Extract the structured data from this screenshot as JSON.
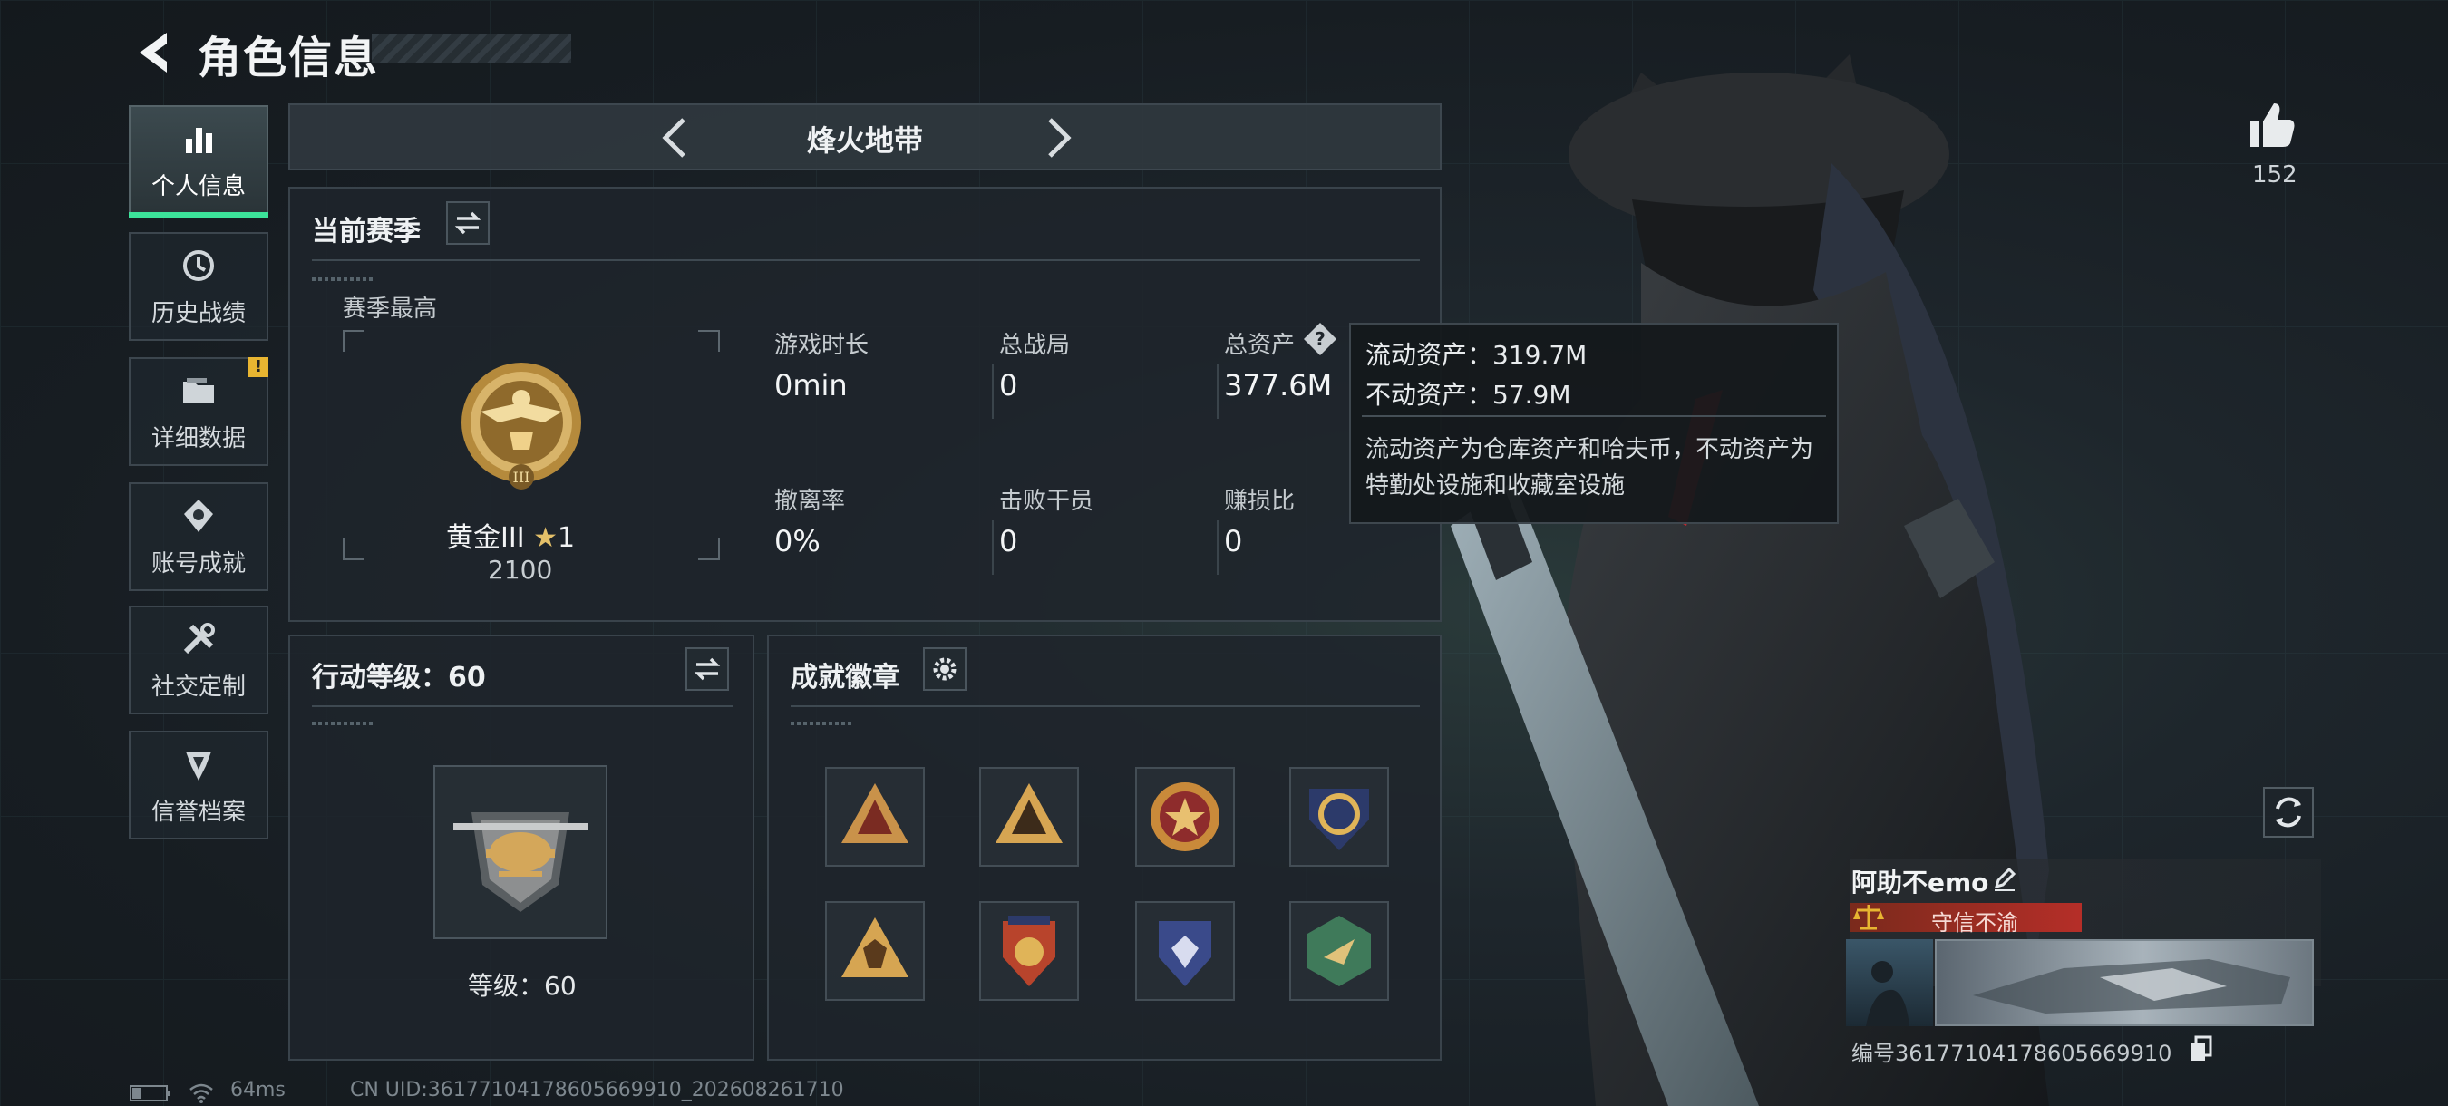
{
  "header": {
    "title": "角色信息"
  },
  "sidebar": {
    "items": [
      {
        "label": "个人信息",
        "icon": "bar-chart-icon",
        "active": true
      },
      {
        "label": "历史战绩",
        "icon": "history-clock-icon"
      },
      {
        "label": "详细数据",
        "icon": "folder-icon",
        "alert": "!"
      },
      {
        "label": "账号成就",
        "icon": "achievement-icon"
      },
      {
        "label": "社交定制",
        "icon": "tools-icon"
      },
      {
        "label": "信誉档案",
        "icon": "shield-icon"
      }
    ]
  },
  "mode": {
    "name": "烽火地带"
  },
  "season": {
    "title": "当前赛季",
    "best_label": "赛季最高",
    "rank_name": "黄金III",
    "rank_stars": "1",
    "rank_score": "2100",
    "stats": [
      {
        "label": "游戏时长",
        "value": "0min"
      },
      {
        "label": "总战局",
        "value": "0"
      },
      {
        "label": "总资产",
        "value": "377.6M"
      },
      {
        "label": "撤离率",
        "value": "0%"
      },
      {
        "label": "击败干员",
        "value": "0"
      },
      {
        "label": "赚损比",
        "value": "0"
      }
    ]
  },
  "tooltip": {
    "line1": "流动资产：319.7M",
    "line2": "不动资产：57.9M",
    "desc": "流动资产为仓库资产和哈夫币，不动资产为特勤处设施和收藏室设施"
  },
  "action_level": {
    "title": "行动等级：60",
    "level_text": "等级：60"
  },
  "achievements": {
    "title": "成就徽章",
    "badges": [
      "badge-1",
      "badge-2",
      "badge-3",
      "badge-4",
      "badge-5",
      "badge-6",
      "badge-7",
      "badge-8"
    ]
  },
  "player": {
    "likes": "152",
    "name": "阿助不emo",
    "credit_tag": "守信不渝",
    "id_text": "编号3617710417860566991​0"
  },
  "footer": {
    "ping": "64ms",
    "uid": "CN UID:36177104178605669910_202608261710"
  }
}
